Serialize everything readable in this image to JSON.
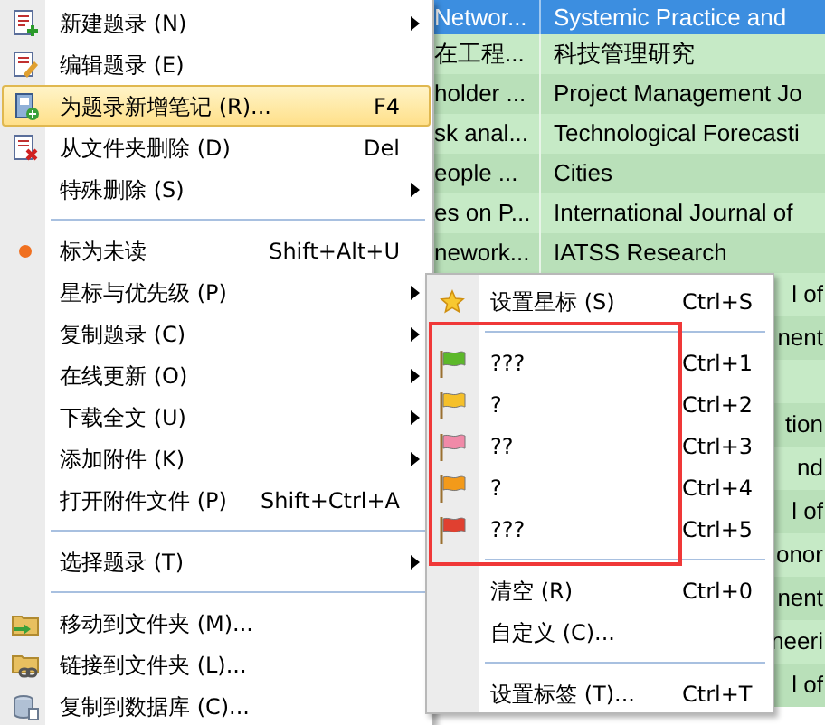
{
  "table": {
    "columns": [
      "Networ...",
      "Systemic Practice and"
    ],
    "rows": [
      {
        "kind": "full",
        "column_1": "在工程...",
        "column_2": "科技管理研究"
      },
      {
        "kind": "full",
        "column_1": "holder ...",
        "column_2": "Project Management Jo"
      },
      {
        "kind": "full",
        "column_1": "sk anal...",
        "column_2": "Technological Forecasti"
      },
      {
        "kind": "full",
        "column_1": "eople ...",
        "column_2": "Cities"
      },
      {
        "kind": "full",
        "column_1": "es on P...",
        "column_2": "International Journal of"
      },
      {
        "kind": "full",
        "column_1": "nework...",
        "column_2": "IATSS Research"
      },
      {
        "kind": "tail",
        "column_2": "l of"
      },
      {
        "kind": "tail",
        "column_2": "nent"
      },
      {
        "kind": "tail"
      },
      {
        "kind": "tail",
        "column_2": "tion"
      },
      {
        "kind": "tail",
        "column_2": "nd"
      },
      {
        "kind": "tail",
        "column_2": "l of"
      },
      {
        "kind": "tail",
        "column_2": "onor"
      },
      {
        "kind": "tail",
        "column_2": "nent"
      },
      {
        "kind": "tail",
        "column_2": "neeri"
      },
      {
        "kind": "tail",
        "column_2": "l of"
      }
    ]
  },
  "context_menu": {
    "items": [
      {
        "kind": "item",
        "label": "新建题录 (N)",
        "submenu": true,
        "selected": false
      },
      {
        "kind": "item",
        "label": "编辑题录 (E)",
        "submenu": false,
        "selected": false
      },
      {
        "kind": "item",
        "label": "为题录新增笔记 (R)...",
        "shortcut": "F4",
        "submenu": false,
        "selected": true
      },
      {
        "kind": "item",
        "label": "从文件夹删除 (D)",
        "shortcut": "Del",
        "submenu": false,
        "selected": false
      },
      {
        "kind": "item",
        "label": "特殊删除 (S)",
        "submenu": true,
        "selected": false
      },
      {
        "kind": "separator"
      },
      {
        "kind": "item",
        "label": "标为未读",
        "shortcut": "Shift+Alt+U",
        "submenu": false,
        "selected": false
      },
      {
        "kind": "item",
        "label": "星标与优先级 (P)",
        "submenu": true,
        "selected": false
      },
      {
        "kind": "item",
        "label": "复制题录 (C)",
        "submenu": true,
        "selected": false
      },
      {
        "kind": "item",
        "label": "在线更新 (O)",
        "submenu": true,
        "selected": false
      },
      {
        "kind": "item",
        "label": "下载全文 (U)",
        "submenu": true,
        "selected": false
      },
      {
        "kind": "item",
        "label": "添加附件 (K)",
        "submenu": true,
        "selected": false
      },
      {
        "kind": "item",
        "label": "打开附件文件 (P)",
        "shortcut": "Shift+Ctrl+A",
        "submenu": false,
        "selected": false
      },
      {
        "kind": "separator"
      },
      {
        "kind": "item",
        "label": "选择题录 (T)",
        "submenu": true,
        "selected": false
      },
      {
        "kind": "separator"
      },
      {
        "kind": "item",
        "label": "移动到文件夹 (M)...",
        "submenu": false,
        "selected": false
      },
      {
        "kind": "item",
        "label": "链接到文件夹 (L)...",
        "submenu": false,
        "selected": false
      },
      {
        "kind": "item",
        "label": "复制到数据库 (C)...",
        "submenu": false,
        "selected": false
      }
    ]
  },
  "submenu": {
    "items": [
      {
        "kind": "star",
        "label": "设置星标 (S)",
        "shortcut": "Ctrl+S"
      },
      {
        "kind": "separator"
      },
      {
        "kind": "flag",
        "label": "???",
        "shortcut": "Ctrl+1",
        "color": "#5cb82a"
      },
      {
        "kind": "flag",
        "label": "?",
        "shortcut": "Ctrl+2",
        "color": "#f5c02a"
      },
      {
        "kind": "flag",
        "label": "??",
        "shortcut": "Ctrl+3",
        "color": "#f08aa8"
      },
      {
        "kind": "flag",
        "label": "?",
        "shortcut": "Ctrl+4",
        "color": "#f39a1a"
      },
      {
        "kind": "flag",
        "label": "???",
        "shortcut": "Ctrl+5",
        "color": "#e04030"
      },
      {
        "kind": "separator"
      },
      {
        "kind": "plain",
        "label": "清空 (R)",
        "shortcut": "Ctrl+0"
      },
      {
        "kind": "plain",
        "label": "自定义 (C)..."
      },
      {
        "kind": "separator"
      },
      {
        "kind": "plain",
        "label": "设置标签 (T)...",
        "shortcut": "Ctrl+T"
      }
    ]
  }
}
